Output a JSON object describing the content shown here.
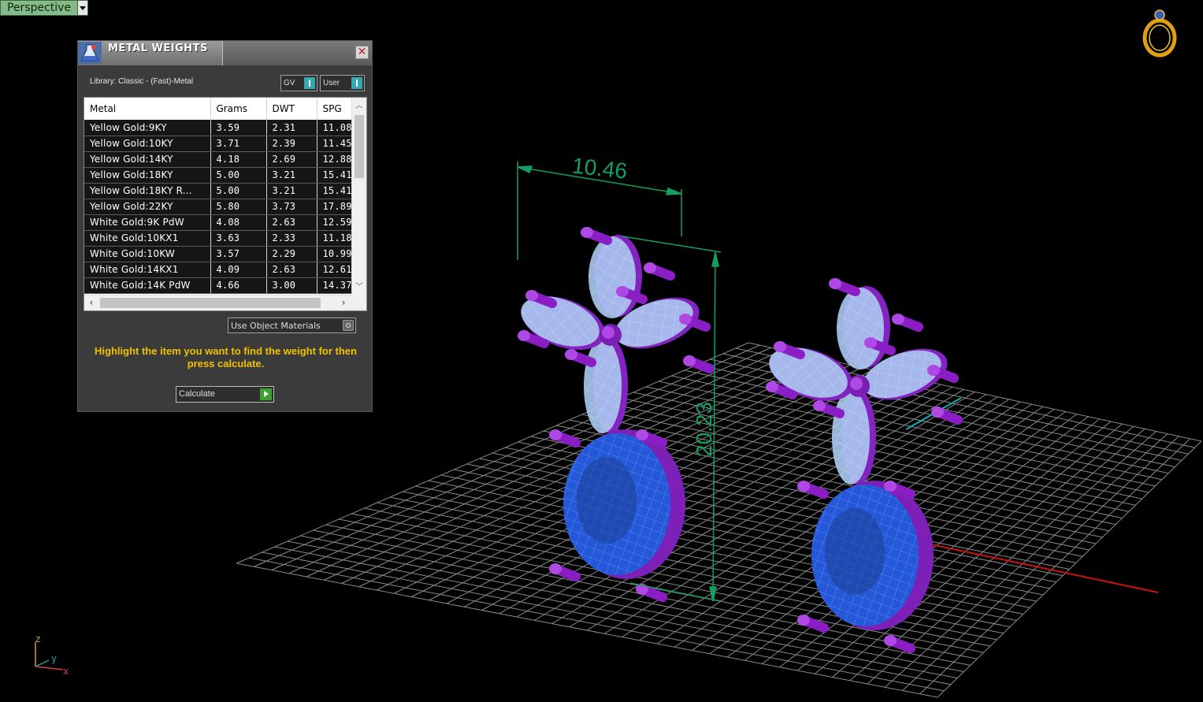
{
  "viewport": {
    "tab_label": "Perspective",
    "dim_width": "10.46",
    "dim_height": "20.23",
    "axis_z": "z",
    "axis_y": "y",
    "axis_x": "x"
  },
  "panel": {
    "title": "METAL WEIGHTS",
    "library": "Library: Classic - (Fast)-Metal",
    "toggle_gv": "GV",
    "toggle_user": "User",
    "columns": [
      "Metal",
      "Grams",
      "DWT",
      "SPG"
    ],
    "rows": [
      [
        "Yellow Gold:9KY",
        "3.59",
        "2.31",
        "11.08"
      ],
      [
        "Yellow Gold:10KY",
        "3.71",
        "2.39",
        "11.45"
      ],
      [
        "Yellow Gold:14KY",
        "4.18",
        "2.69",
        "12.88"
      ],
      [
        "Yellow Gold:18KY",
        "5.00",
        "3.21",
        "15.41"
      ],
      [
        "Yellow Gold:18KY R...",
        "5.00",
        "3.21",
        "15.41"
      ],
      [
        "Yellow Gold:22KY",
        "5.80",
        "3.73",
        "17.89"
      ],
      [
        "White Gold:9K PdW",
        "4.08",
        "2.63",
        "12.59"
      ],
      [
        "White Gold:10KX1",
        "3.63",
        "2.33",
        "11.18"
      ],
      [
        "White Gold:10KW",
        "3.57",
        "2.29",
        "10.99"
      ],
      [
        "White Gold:14KX1",
        "4.09",
        "2.63",
        "12.61"
      ],
      [
        "White Gold:14K PdW",
        "4.66",
        "3.00",
        "14.37"
      ]
    ],
    "use_object_materials": "Use Object Materials",
    "hint": "Highlight the item you want to find the weight for then press calculate.",
    "calculate": "Calculate"
  },
  "colors": {
    "metal": "#9a2ed0",
    "stone_light": "#a8c8f0",
    "stone_deep": "#1a5ad8",
    "dimension": "#12a060",
    "grid": "#8a8a8a",
    "axis_x": "#d01010",
    "axis_y": "#10b0b0",
    "hint": "#f2c200"
  }
}
